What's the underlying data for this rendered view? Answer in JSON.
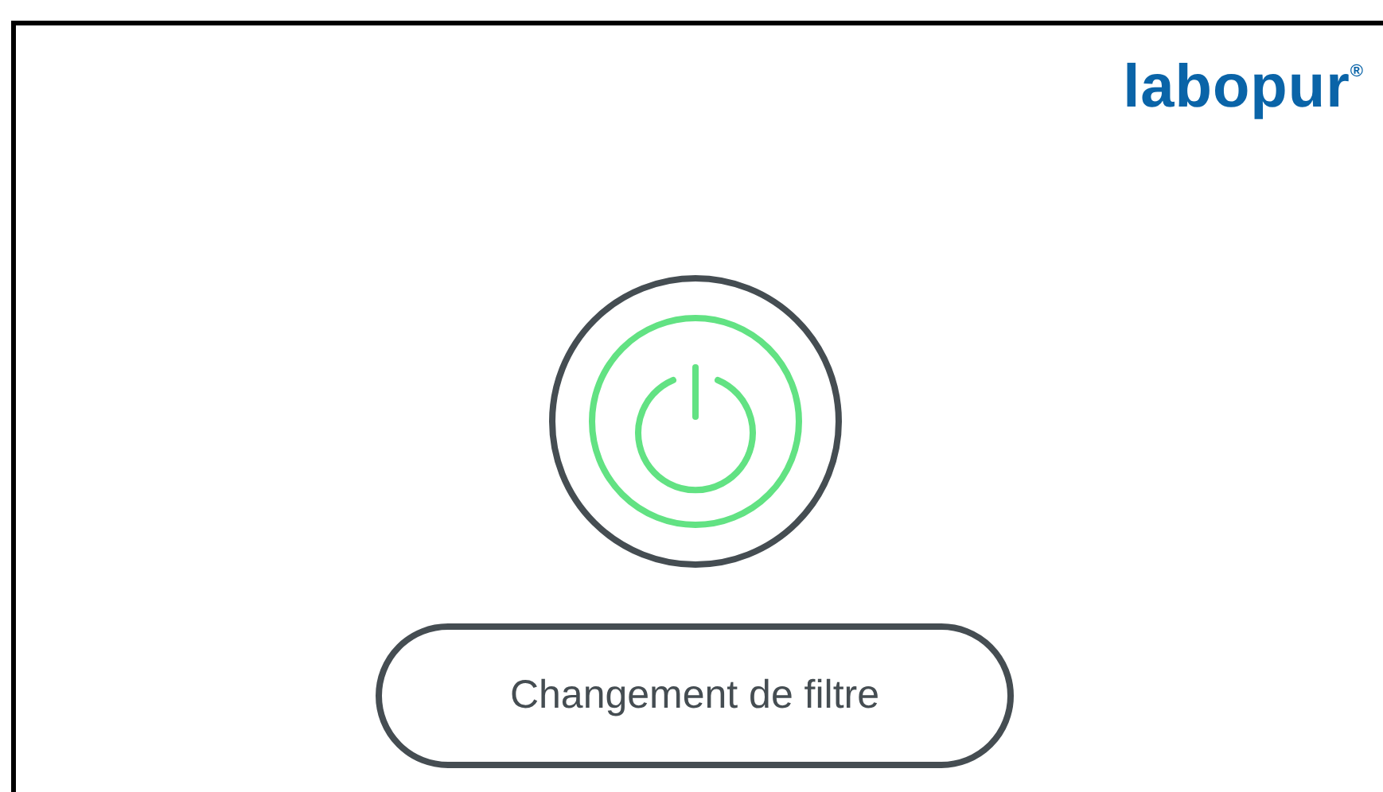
{
  "logo": {
    "text": "labopur$^{®}$"
  },
  "power_button": {
    "on": true
  },
  "button": {
    "label": "Changement de filtre"
  }
}
